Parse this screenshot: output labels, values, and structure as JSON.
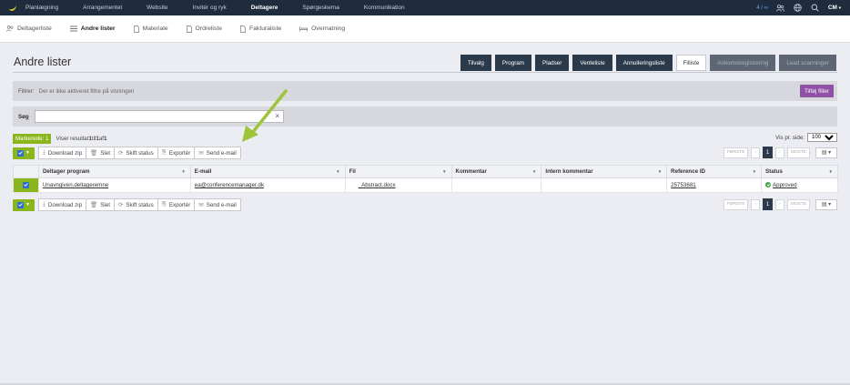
{
  "topnav": {
    "items": [
      "Planlægning",
      "Arrangementet",
      "Website",
      "Invitér og ryk",
      "Deltagere",
      "Spørgeskema",
      "Kommunikation"
    ],
    "active_index": 4,
    "count": "4 / ∞",
    "user": "CM",
    "icons": [
      "people-icon",
      "globe-icon",
      "search-icon"
    ]
  },
  "subnav": {
    "items": [
      {
        "label": "Deltagerliste",
        "icon": "people-icon"
      },
      {
        "label": "Andre lister",
        "icon": "list-icon"
      },
      {
        "label": "Materiale",
        "icon": "document-icon"
      },
      {
        "label": "Ordreliste",
        "icon": "document-icon"
      },
      {
        "label": "Fakturaliste",
        "icon": "document-icon"
      },
      {
        "label": "Overnatning",
        "icon": "bed-icon"
      }
    ],
    "active_index": 1
  },
  "page": {
    "title": "Andre lister",
    "tabs": [
      {
        "label": "Tilvalg",
        "state": "normal"
      },
      {
        "label": "Program",
        "state": "normal"
      },
      {
        "label": "Pladser",
        "state": "normal"
      },
      {
        "label": "Venteliste",
        "state": "normal"
      },
      {
        "label": "Annulleringsliste",
        "state": "normal"
      },
      {
        "label": "Filliste",
        "state": "active"
      },
      {
        "label": "Ankomstregistrering",
        "state": "disabled"
      },
      {
        "label": "Lead scanninger",
        "state": "disabled"
      }
    ]
  },
  "filter": {
    "label": "Filtrer:",
    "text": "Der er ikke aktiveret filtre på visningen",
    "add_button": "Tilføj filter"
  },
  "search": {
    "label": "Søg",
    "value": "",
    "clear": "×"
  },
  "results": {
    "marked": "Markerede: 1",
    "showing_prefix": "Viser resultat ",
    "from": "1",
    "to_word": " til ",
    "to": "1",
    "of_word": " af ",
    "total": "1"
  },
  "toolbar": {
    "download": "Download zip",
    "delete": "Slet",
    "change_status": "Skift status",
    "export": "Exportér",
    "send_email": "Send e-mail"
  },
  "pagination": {
    "per_page_label": "Vis pr. side:",
    "per_page_value": "100",
    "first": "FØRSTE",
    "prev": "‹",
    "current": "1",
    "next": "›",
    "last": "SIDSTE"
  },
  "table": {
    "columns": [
      "Deltager program",
      "E-mail",
      "Fil",
      "Kommentar",
      "Intern kommentar",
      "Reference ID",
      "Status"
    ],
    "rows": [
      {
        "deltager": "Unavngiven.deltageremne",
        "email": "ea@conferencemanager.dk",
        "fil": "_Abstract.docx",
        "kommentar": "",
        "intern": "",
        "ref": "25753681",
        "status": "Approved"
      }
    ]
  },
  "colors": {
    "nav_bg": "#1e2c3d",
    "accent_green": "#8ab51c",
    "accent_purple": "#8e4fa5",
    "tab_dark": "#2b3a4b",
    "annotation_arrow": "#9dc43a"
  }
}
